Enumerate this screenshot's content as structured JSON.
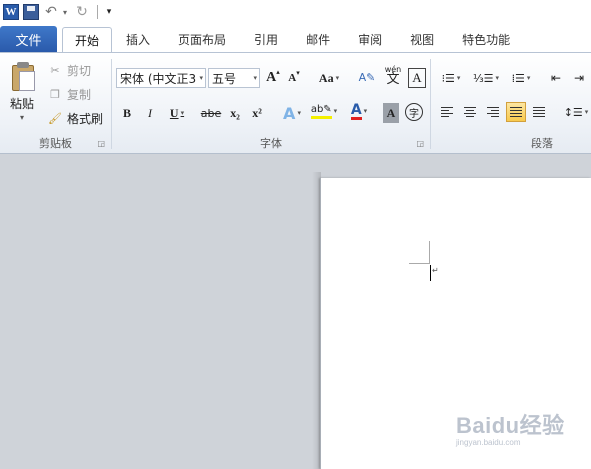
{
  "qat": {
    "app_icon_letter": "W",
    "icons": [
      "word-icon",
      "save-icon",
      "undo-icon",
      "redo-icon",
      "customize-icon"
    ]
  },
  "tabs": [
    {
      "label": "文件",
      "active": false,
      "type": "file"
    },
    {
      "label": "开始",
      "active": true
    },
    {
      "label": "插入",
      "active": false
    },
    {
      "label": "页面布局",
      "active": false
    },
    {
      "label": "引用",
      "active": false
    },
    {
      "label": "邮件",
      "active": false
    },
    {
      "label": "审阅",
      "active": false
    },
    {
      "label": "视图",
      "active": false
    },
    {
      "label": "特色功能",
      "active": false
    }
  ],
  "clipboard": {
    "paste_label": "粘贴",
    "cut_label": "剪切",
    "copy_label": "复制",
    "format_painter_label": "格式刷",
    "group_label": "剪贴板"
  },
  "font": {
    "font_name": "宋体 (中文正3",
    "font_size": "五号",
    "grow_label": "A",
    "shrink_label": "A",
    "change_case_label": "Aa",
    "bold_label": "B",
    "italic_label": "I",
    "underline_label": "U",
    "strike_label": "abe",
    "subscript_label": "x₂",
    "superscript_label": "x²",
    "font_color_label": "A",
    "char_shading_label": "A",
    "enclosed_label": "字",
    "phonetic_label": "wén",
    "phonetic_char": "文",
    "char_border_label": "A",
    "group_label": "字体"
  },
  "paragraph": {
    "group_label": "段落"
  },
  "watermark": {
    "main": "Baidu经验",
    "sub": "jingyan.baidu.com"
  },
  "colors": {
    "file_tab": "#2a5aab",
    "ribbon_bg": "#eef2f7",
    "doc_bg": "#cfd3d9",
    "active_align": "#f8c94d"
  }
}
